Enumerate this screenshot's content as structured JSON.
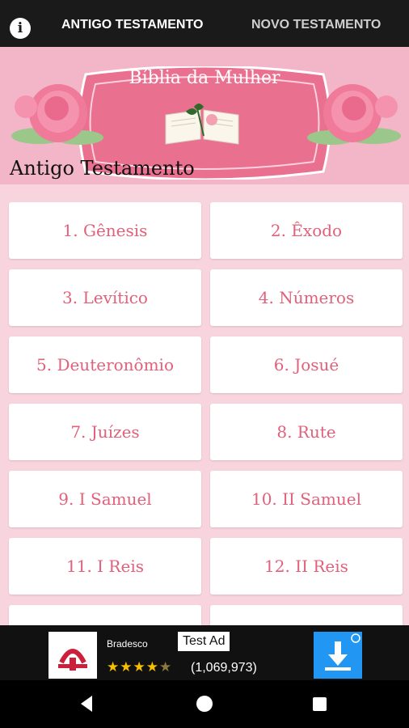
{
  "tabs": [
    {
      "label": "ANTIGO TESTAMENTO",
      "active": true
    },
    {
      "label": "NOVO TESTAMENTO",
      "active": false
    }
  ],
  "info_icon": "info-icon",
  "banner": {
    "title": "Bíblia da Mulher",
    "section_title": "Antigo Testamento"
  },
  "books": [
    {
      "label": "1. Gênesis"
    },
    {
      "label": "2. Êxodo"
    },
    {
      "label": "3. Levítico"
    },
    {
      "label": "4. Números"
    },
    {
      "label": "5. Deuteronômio"
    },
    {
      "label": "6. Josué"
    },
    {
      "label": "7. Juízes"
    },
    {
      "label": "8. Rute"
    },
    {
      "label": "9. I Samuel"
    },
    {
      "label": "10. II Samuel"
    },
    {
      "label": "11. I Reis"
    },
    {
      "label": "12. II Reis"
    },
    {
      "label": ""
    },
    {
      "label": ""
    }
  ],
  "ad": {
    "brand": "Bradesco",
    "badge": "Test Ad",
    "rating_count": "(1,069,973)",
    "rating": 4.5
  },
  "colors": {
    "accent": "#e2607a",
    "banner_bg": "#f3b6c8",
    "grid_bg": "#f8d4df"
  }
}
